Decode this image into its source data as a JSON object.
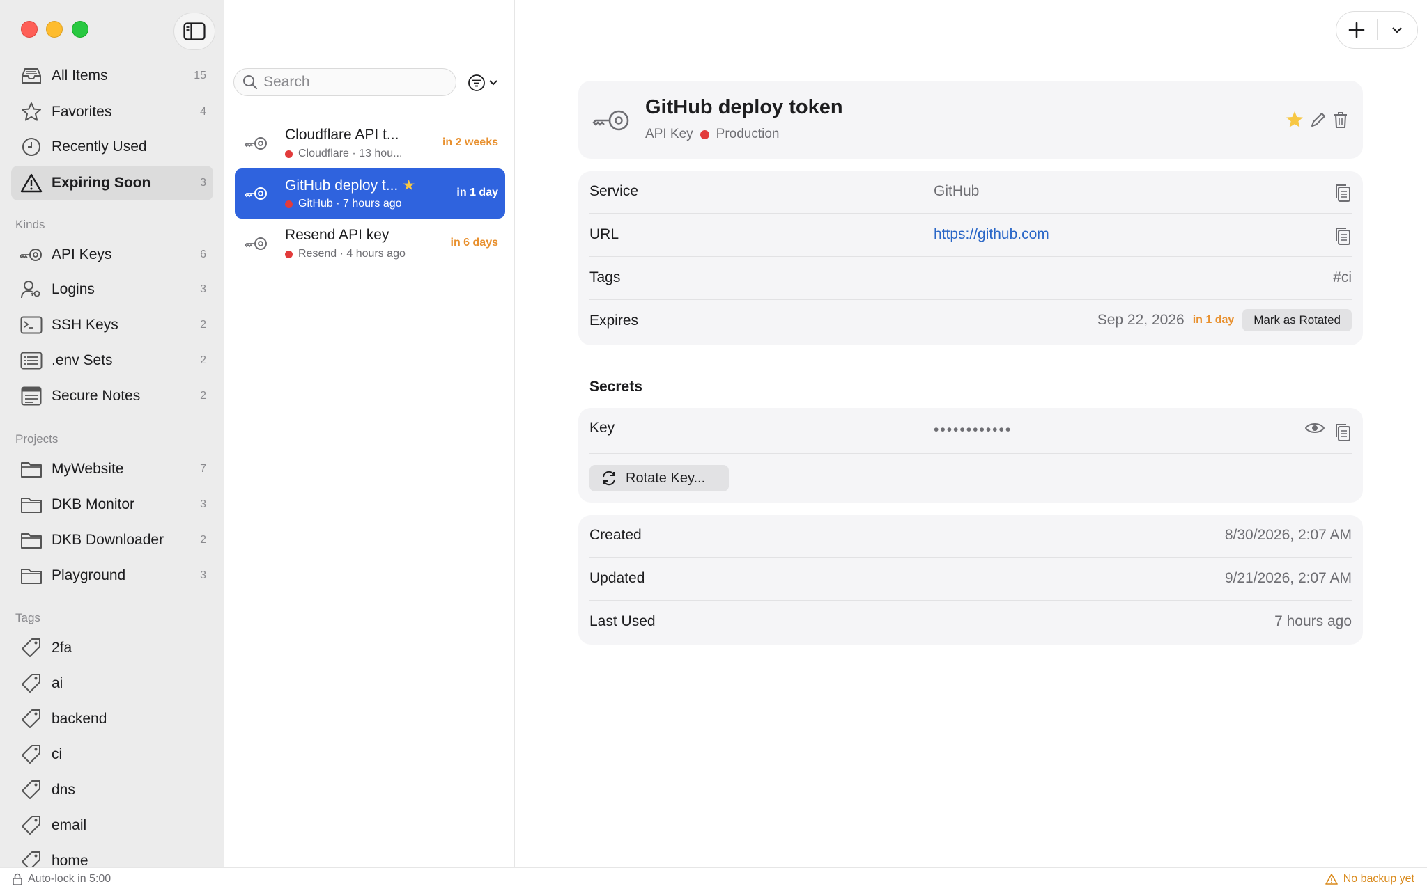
{
  "sidebar": {
    "library": [
      {
        "label": "All Items",
        "count": "15",
        "icon": "tray-icon"
      },
      {
        "label": "Favorites",
        "count": "4",
        "icon": "star-icon"
      },
      {
        "label": "Recently Used",
        "count": "",
        "icon": "clock-icon"
      },
      {
        "label": "Expiring Soon",
        "count": "3",
        "icon": "warning-icon"
      }
    ],
    "kinds_heading": "Kinds",
    "kinds": [
      {
        "label": "API Keys",
        "count": "6",
        "icon": "key-icon"
      },
      {
        "label": "Logins",
        "count": "3",
        "icon": "person-key-icon"
      },
      {
        "label": "SSH Keys",
        "count": "2",
        "icon": "terminal-icon"
      },
      {
        "label": ".env Sets",
        "count": "2",
        "icon": "list-icon"
      },
      {
        "label": "Secure Notes",
        "count": "2",
        "icon": "note-icon"
      }
    ],
    "projects_heading": "Projects",
    "projects": [
      {
        "label": "MyWebsite",
        "count": "7",
        "icon": "folder-icon"
      },
      {
        "label": "DKB Monitor",
        "count": "3",
        "icon": "folder-icon"
      },
      {
        "label": "DKB Downloader",
        "count": "2",
        "icon": "folder-icon"
      },
      {
        "label": "Playground",
        "count": "3",
        "icon": "folder-icon"
      }
    ],
    "tags_heading": "Tags",
    "tags": [
      {
        "label": "2fa",
        "icon": "tag-icon"
      },
      {
        "label": "ai",
        "icon": "tag-icon"
      },
      {
        "label": "backend",
        "icon": "tag-icon"
      },
      {
        "label": "ci",
        "icon": "tag-icon"
      },
      {
        "label": "dns",
        "icon": "tag-icon"
      },
      {
        "label": "email",
        "icon": "tag-icon"
      },
      {
        "label": "home",
        "icon": "tag-icon"
      }
    ]
  },
  "status": {
    "autolock": "Auto-lock in 5:00",
    "backup": "No backup yet",
    "warning_color": "#d9891a"
  },
  "list": {
    "search_placeholder": "Search",
    "items": [
      {
        "title": "Cloudflare API t...",
        "subtitle": "Cloudflare · 13 hou...",
        "expiry": "in 2 weeks",
        "favorite": false
      },
      {
        "title": "GitHub deploy t...",
        "subtitle": "GitHub · 7 hours ago",
        "expiry": "in 1 day",
        "favorite": true
      },
      {
        "title": "Resend API key",
        "subtitle": "Resend · 4 hours ago",
        "expiry": "in 6 days",
        "favorite": false
      }
    ],
    "selected_color": "#2f63de",
    "expiry_color": "#e8902e"
  },
  "detail": {
    "title": "GitHub deploy token",
    "kind": "API Key",
    "environment": "Production",
    "environment_color": "#e23b3b",
    "fields": {
      "service_label": "Service",
      "service_value": "GitHub",
      "url_label": "URL",
      "url_value": "https://github.com",
      "tags_label": "Tags",
      "tags_value": "#ci",
      "expires_label": "Expires",
      "expires_date": "Sep 22, 2026",
      "expires_relative": "in 1 day",
      "mark_rotated": "Mark as Rotated"
    },
    "secrets": {
      "heading": "Secrets",
      "key_label": "Key",
      "key_masked": "••••••••••••",
      "rotate_label": "Rotate Key..."
    },
    "timestamps": {
      "created_label": "Created",
      "created_value": "8/30/2026, 2:07 AM",
      "updated_label": "Updated",
      "updated_value": "9/21/2026, 2:07 AM",
      "last_used_label": "Last Used",
      "last_used_value": "7 hours ago"
    }
  }
}
